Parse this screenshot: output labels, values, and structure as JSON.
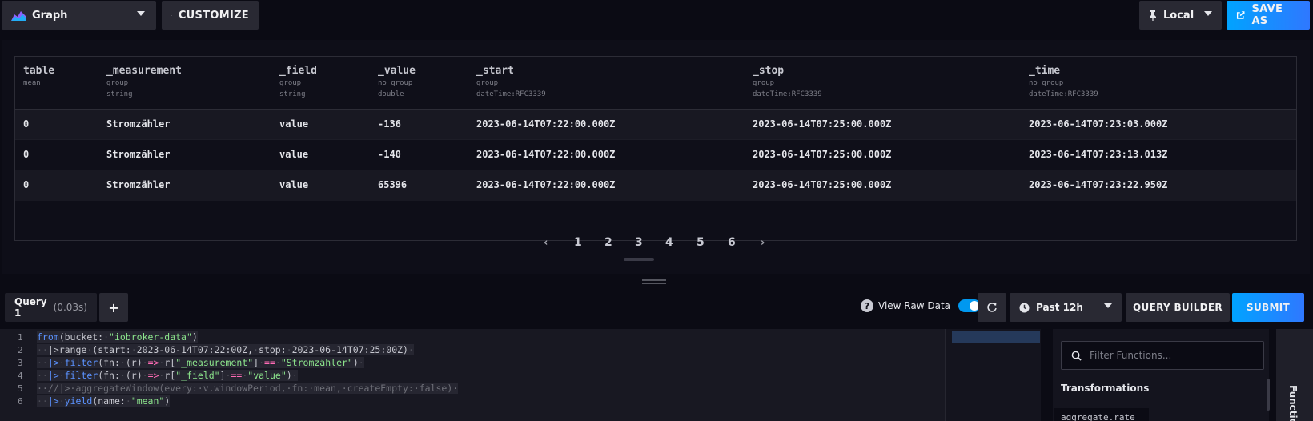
{
  "toolbar": {
    "viz_type": "Graph",
    "customize_label": "CUSTOMIZE",
    "timezone": "Local",
    "save_as_label": "SAVE AS"
  },
  "table": {
    "columns": [
      {
        "name": "table",
        "group": "mean",
        "type": ""
      },
      {
        "name": "_measurement",
        "group": "group",
        "type": "string"
      },
      {
        "name": "_field",
        "group": "group",
        "type": "string"
      },
      {
        "name": "_value",
        "group": "no group",
        "type": "double"
      },
      {
        "name": "_start",
        "group": "group",
        "type": "dateTime:RFC3339"
      },
      {
        "name": "_stop",
        "group": "group",
        "type": "dateTime:RFC3339"
      },
      {
        "name": "_time",
        "group": "no group",
        "type": "dateTime:RFC3339"
      }
    ],
    "rows": [
      [
        "0",
        "Stromzähler",
        "value",
        "-136",
        "2023-06-14T07:22:00.000Z",
        "2023-06-14T07:25:00.000Z",
        "2023-06-14T07:23:03.000Z"
      ],
      [
        "0",
        "Stromzähler",
        "value",
        "-140",
        "2023-06-14T07:22:00.000Z",
        "2023-06-14T07:25:00.000Z",
        "2023-06-14T07:23:13.013Z"
      ],
      [
        "0",
        "Stromzähler",
        "value",
        "65396",
        "2023-06-14T07:22:00.000Z",
        "2023-06-14T07:25:00.000Z",
        "2023-06-14T07:23:22.950Z"
      ]
    ]
  },
  "pagination": {
    "prev": "‹",
    "next": "›",
    "pages": [
      "1",
      "2",
      "3",
      "4",
      "5",
      "6"
    ],
    "current": "3"
  },
  "query": {
    "tab_label": "Query 1",
    "tab_duration": "(0.03s)",
    "add_label": "+",
    "raw_data_label": "View Raw Data",
    "raw_data_on": true,
    "time_range": "Past 12h",
    "query_builder_label": "QUERY BUILDER",
    "submit_label": "SUBMIT"
  },
  "editor": {
    "line_numbers": [
      "1",
      "2",
      "3",
      "4",
      "5",
      "6"
    ]
  },
  "functions": {
    "search_placeholder": "Filter Functions...",
    "heading": "Transformations",
    "first_item": "aggregate.rate",
    "side_tab": "Functions"
  },
  "colors": {
    "accent": "#00a3ff",
    "background": "#0b0b14",
    "panel": "#292933"
  }
}
